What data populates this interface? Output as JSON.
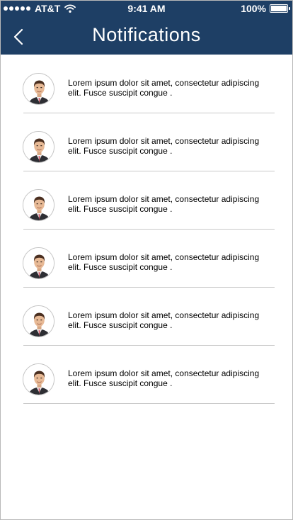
{
  "status_bar": {
    "carrier": "AT&T",
    "time": "9:41 AM",
    "battery": "100%"
  },
  "header": {
    "title": "Notifications",
    "back_icon": "chevron-left-icon",
    "background": "#1e3f65"
  },
  "notifications": [
    {
      "text": "Lorem ipsum dolor sit amet, consectetur adipiscing elit. Fusce suscipit congue .",
      "avatar_icon": "avatar"
    },
    {
      "text": "Lorem ipsum dolor sit amet, consectetur adipiscing elit. Fusce suscipit congue .",
      "avatar_icon": "avatar"
    },
    {
      "text": "Lorem ipsum dolor sit amet, consectetur adipiscing elit. Fusce suscipit congue .",
      "avatar_icon": "avatar"
    },
    {
      "text": "Lorem ipsum dolor sit amet, consectetur adipiscing elit. Fusce suscipit congue .",
      "avatar_icon": "avatar"
    },
    {
      "text": "Lorem ipsum dolor sit amet, consectetur adipiscing elit. Fusce suscipit congue .",
      "avatar_icon": "avatar"
    },
    {
      "text": "Lorem ipsum dolor sit amet, consectetur adipiscing elit. Fusce suscipit congue .",
      "avatar_icon": "avatar"
    }
  ]
}
